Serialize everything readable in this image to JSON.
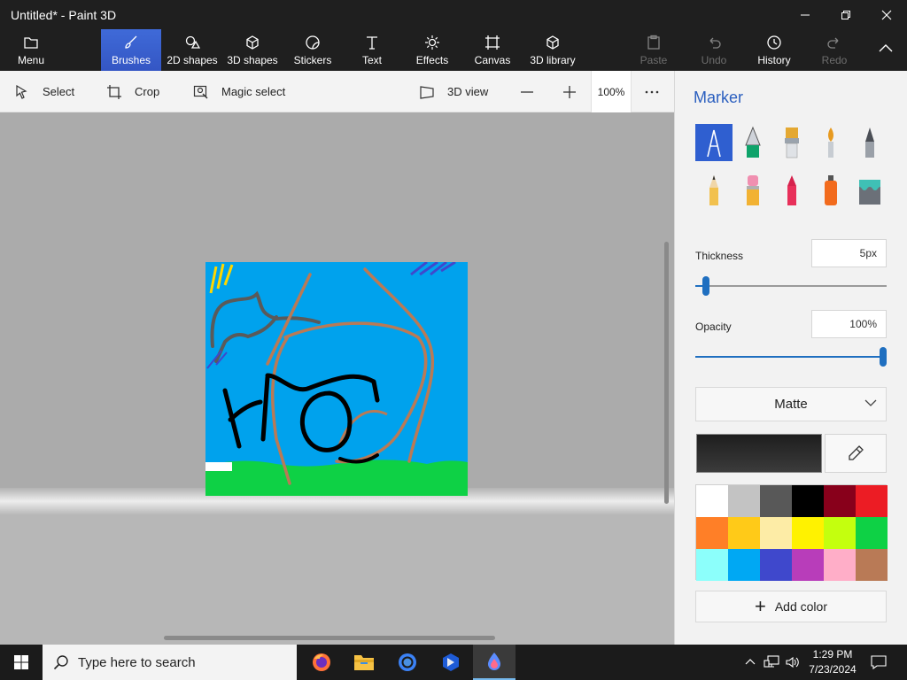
{
  "window": {
    "title": "Untitled* - Paint 3D",
    "minimize_icon": "minimize-icon",
    "maximize_icon": "restore-icon",
    "close_icon": "close-icon"
  },
  "ribbon": {
    "menu": "Menu",
    "tabs": [
      {
        "label": "Brushes",
        "icon": "brush-icon",
        "active": true
      },
      {
        "label": "2D shapes",
        "icon": "2d-shapes-icon"
      },
      {
        "label": "3D shapes",
        "icon": "3d-shapes-icon"
      },
      {
        "label": "Stickers",
        "icon": "stickers-icon"
      },
      {
        "label": "Text",
        "icon": "text-icon"
      },
      {
        "label": "Effects",
        "icon": "effects-icon"
      },
      {
        "label": "Canvas",
        "icon": "canvas-icon"
      },
      {
        "label": "3D library",
        "icon": "3d-library-icon"
      }
    ],
    "actions": [
      {
        "label": "Paste",
        "icon": "paste-icon",
        "enabled": false
      },
      {
        "label": "Undo",
        "icon": "undo-icon",
        "enabled": false
      },
      {
        "label": "History",
        "icon": "history-icon",
        "enabled": true
      },
      {
        "label": "Redo",
        "icon": "redo-icon",
        "enabled": false
      }
    ]
  },
  "toolbar": {
    "select": "Select",
    "crop": "Crop",
    "magic_select": "Magic select",
    "view_3d": "3D view",
    "zoom": "100%"
  },
  "panel": {
    "title": "Marker",
    "brushes": [
      "marker",
      "calligraphy-pen",
      "oil-brush",
      "watercolor",
      "pixel-pen",
      "pencil",
      "eraser",
      "crayon",
      "spray-can",
      "fill"
    ],
    "selected_brush": "marker",
    "thickness_label": "Thickness",
    "thickness_value": "5px",
    "thickness_level": 0.05,
    "opacity_label": "Opacity",
    "opacity_value": "100%",
    "opacity_level": 1.0,
    "finish": "Matte",
    "current_color": "#1e1e1e",
    "palette": [
      "#ffffff",
      "#c3c3c3",
      "#585858",
      "#000000",
      "#88001b",
      "#ec1c24",
      "#ff7f27",
      "#ffca18",
      "#fdeca6",
      "#fff200",
      "#c4ff0e",
      "#0ed145",
      "#8cfffb",
      "#00a8f3",
      "#3f48cc",
      "#b83dba",
      "#ffaec8",
      "#b97a56"
    ],
    "add_color": "Add color"
  },
  "taskbar": {
    "search_placeholder": "Type here to search",
    "apps": [
      "firefox-icon",
      "file-explorer-icon",
      "chrome-icon",
      "photos-icon",
      "paint-3d-icon"
    ],
    "time": "1:29 PM",
    "date": "7/23/2024"
  },
  "colors": {
    "accent": "#2f5fd0",
    "canvas_sky": "#00a2ed",
    "grass": "#0ed145",
    "brown_stroke": "#b97a56"
  }
}
